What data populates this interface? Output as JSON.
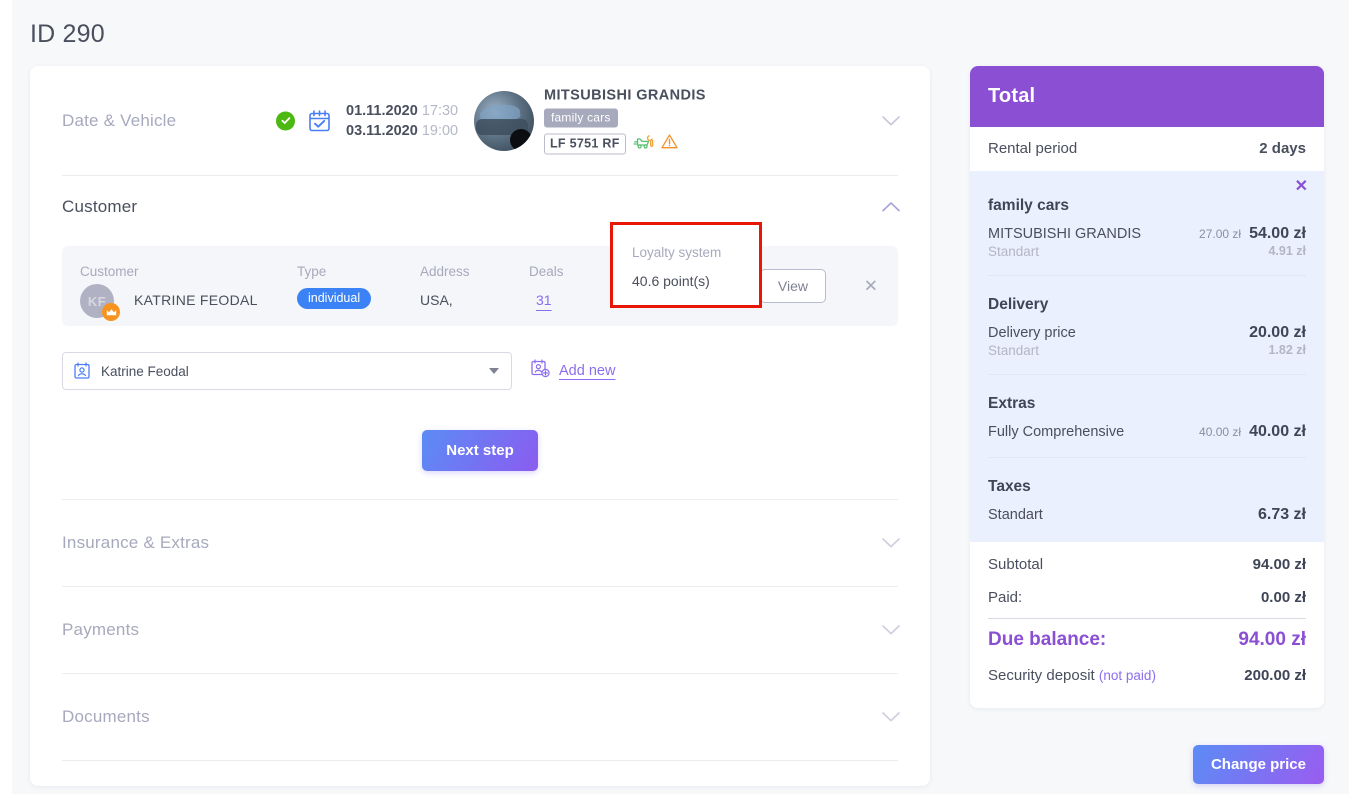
{
  "header": {
    "title": "ID 290"
  },
  "booking": {
    "date_vehicle": {
      "section_label": "Date & Vehicle",
      "status_icon": "check-circle-icon",
      "calendar_icon": "calendar-check-icon",
      "start_date": "01.11.2020",
      "start_time": "17:30",
      "end_date": "03.11.2020",
      "end_time": "19:00",
      "vehicle_name": "MITSUBISHI GRANDIS",
      "vehicle_tag": "family cars",
      "vehicle_plate": "LF 5751 RF",
      "service_icon": "car-repair-icon",
      "warning_icon": "warning-triangle-icon",
      "chevron": "chevron-down-icon"
    },
    "customer": {
      "section_label": "Customer",
      "chevron": "chevron-up-icon",
      "columns": {
        "customer": "Customer",
        "type": "Type",
        "address": "Address",
        "deals": "Deals",
        "loyalty": "Loyalty system"
      },
      "avatar_initials": "KF",
      "crown_icon": "crown-icon",
      "name": "KATRINE FEODAL",
      "type_badge": "individual",
      "address": "USA,",
      "deals_count": "31",
      "loyalty_points": "40.6 point(s)",
      "view_button": "View",
      "close_icon": "close-icon",
      "select": {
        "icon": "contact-card-icon",
        "value": "Katrine Feodal",
        "caret_icon": "caret-down-icon"
      },
      "add_new": {
        "icon": "add-contact-icon",
        "label": "Add new"
      },
      "next_step_button": "Next step"
    },
    "sections": [
      {
        "label": "Insurance & Extras",
        "chevron": "chevron-down-icon"
      },
      {
        "label": "Payments",
        "chevron": "chevron-down-icon"
      },
      {
        "label": "Documents",
        "chevron": "chevron-down-icon"
      }
    ]
  },
  "total": {
    "title": "Total",
    "rental_period_label": "Rental period",
    "rental_period_value": "2 days",
    "close_icon": "close-icon",
    "groups": [
      {
        "title": "family cars",
        "items": [
          {
            "name": "MITSUBISHI GRANDIS",
            "unit_price": "27.00 zł",
            "total": "54.00 zł",
            "sub_name": "Standart",
            "sub_value": "4.91 zł"
          }
        ]
      },
      {
        "title": "Delivery",
        "items": [
          {
            "name": "Delivery price",
            "unit_price": "",
            "total": "20.00 zł",
            "sub_name": "Standart",
            "sub_value": "1.82 zł"
          }
        ]
      },
      {
        "title": "Extras",
        "items": [
          {
            "name": "Fully Comprehensive",
            "unit_price": "40.00 zł",
            "total": "40.00 zł",
            "sub_name": "",
            "sub_value": ""
          }
        ]
      },
      {
        "title": "Taxes",
        "items": [
          {
            "name": "Standart",
            "unit_price": "",
            "total": "6.73 zł",
            "sub_name": "",
            "sub_value": ""
          }
        ]
      }
    ],
    "subtotal_label": "Subtotal",
    "subtotal_value": "94.00 zł",
    "paid_label": "Paid:",
    "paid_value": "0.00 zł",
    "due_label": "Due balance:",
    "due_value": "94.00 zł",
    "deposit_label": "Security deposit",
    "deposit_note": "(not paid)",
    "deposit_value": "200.00 zł",
    "change_price_button": "Change price"
  },
  "colors": {
    "purple": "#8b4fd4",
    "link_purple": "#8b6ef0",
    "blue_badge": "#3b82f6",
    "green_check": "#4cb811",
    "crown_orange": "#f79421",
    "highlight_red": "#e81606",
    "panel_blue": "#eaf0fd",
    "page_bg": "#f7f8fa"
  }
}
